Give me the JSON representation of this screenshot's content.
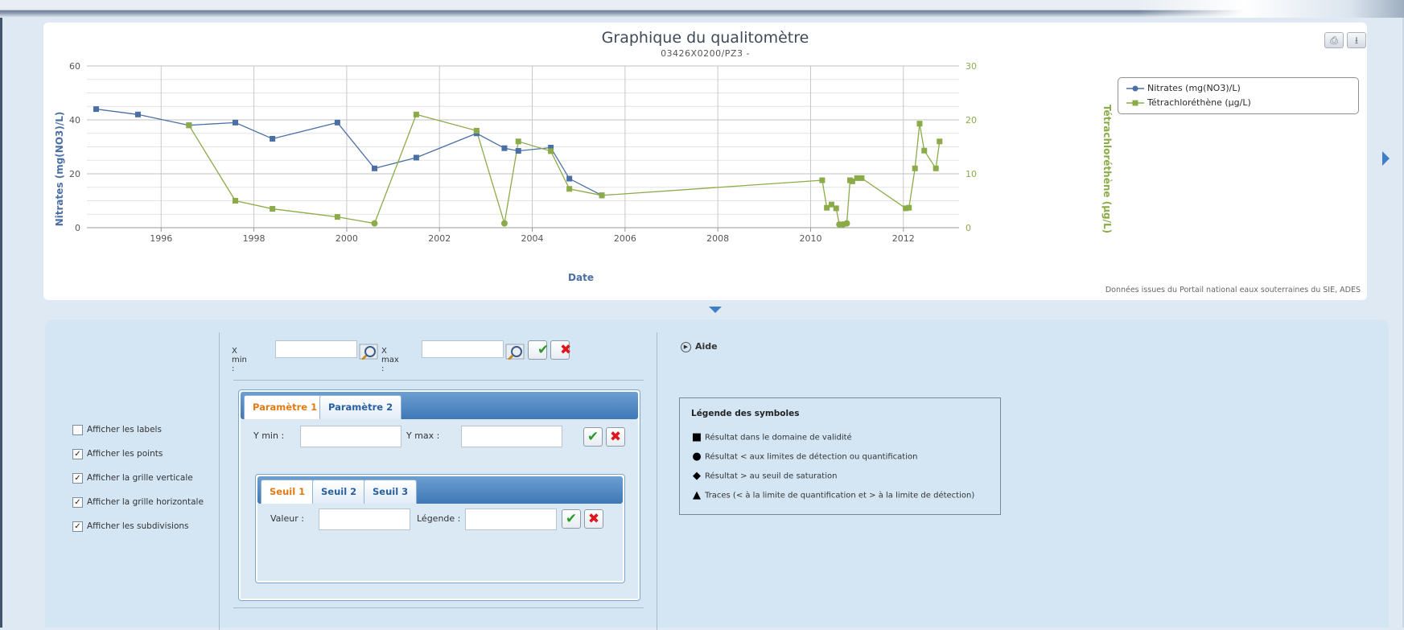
{
  "chart_data": {
    "type": "line",
    "title": "Graphique du qualitomètre",
    "subtitle": "03426X0200/PZ3 -",
    "xlabel": "Date",
    "ylabel_left": "Nitrates (mg(NO3)/L)",
    "ylabel_right": "Tétrachloréthène (µg/L)",
    "xlim": [
      1994.4,
      2013.2
    ],
    "ylim_left": [
      0,
      60
    ],
    "ylim_right": [
      0,
      30
    ],
    "x_ticks": [
      "1996",
      "1998",
      "2000",
      "2002",
      "2004",
      "2006",
      "2008",
      "2010",
      "2012"
    ],
    "y_ticks_left": [
      "0",
      "20",
      "40",
      "60"
    ],
    "y_ticks_right": [
      "0",
      "10",
      "20",
      "30"
    ],
    "grid": true,
    "legend_position": "top-right",
    "series": [
      {
        "name": "Nitrates (mg(NO3)/L)",
        "axis": "left",
        "color": "#4a6fa5",
        "x": [
          1994.6,
          1995.5,
          1996.6,
          1997.6,
          1998.4,
          1999.8,
          2000.6,
          2001.5,
          2002.8,
          2003.4,
          2003.7,
          2004.4,
          2004.8,
          2005.5
        ],
        "y": [
          44,
          42,
          38,
          39,
          33,
          39,
          22,
          26,
          35,
          29.5,
          28.5,
          29.7,
          18.2,
          12
        ]
      },
      {
        "name": "Tétrachloréthène (µg/L)",
        "axis": "right",
        "color": "#8bab48",
        "x": [
          1996.6,
          1997.6,
          1998.4,
          1999.8,
          2000.6,
          2001.5,
          2002.8,
          2003.4,
          2003.7,
          2004.4,
          2004.8,
          2005.5,
          2010.25,
          2010.35,
          2010.45,
          2010.55,
          2010.62,
          2010.7,
          2010.78,
          2010.85,
          2010.9,
          2011.0,
          2011.1,
          2012.05,
          2012.12,
          2012.25,
          2012.35,
          2012.45,
          2012.7,
          2012.78
        ],
        "y": [
          19,
          5,
          3.5,
          2,
          0.8,
          21,
          18,
          0.8,
          16,
          14.2,
          7.2,
          6,
          8.8,
          3.7,
          4.3,
          3.6,
          0.6,
          0.6,
          0.8,
          8.8,
          8.6,
          9.2,
          9.2,
          3.6,
          3.7,
          11,
          19.3,
          14.3,
          11,
          16
        ]
      }
    ]
  },
  "credits": "Données issues du Portail national eaux souterraines du SIE, ADES",
  "toolbar": {
    "print_icon": "print-icon",
    "export_icon": "download-icon"
  },
  "options": {
    "items": [
      {
        "label": "Afficher les labels",
        "checked": false
      },
      {
        "label": "Afficher les points",
        "checked": true
      },
      {
        "label": "Afficher la grille verticale",
        "checked": true
      },
      {
        "label": "Afficher la grille horizontale",
        "checked": true
      },
      {
        "label": "Afficher les subdivisions",
        "checked": true
      }
    ]
  },
  "xrange": {
    "xmin_label": "X min :",
    "xmax_label": "X max :",
    "xmin_value": "",
    "xmax_value": ""
  },
  "params": {
    "tabs": [
      "Paramètre 1",
      "Paramètre 2"
    ],
    "active_tab": "Paramètre 1",
    "ymin_label": "Y min :",
    "ymax_label": "Y max :",
    "ymin_value": "",
    "ymax_value": ""
  },
  "seuils": {
    "tabs": [
      "Seuil 1",
      "Seuil 2",
      "Seuil 3"
    ],
    "active_tab": "Seuil 1",
    "valeur_label": "Valeur :",
    "legende_label": "Légende :",
    "valeur_value": "",
    "legende_value": ""
  },
  "aide": {
    "label": "Aide"
  },
  "symbols_legend": {
    "title": "Légende des symboles",
    "items": [
      {
        "shape": "■",
        "icon": "square-icon",
        "text": "Résultat dans le domaine de validité"
      },
      {
        "shape": "●",
        "icon": "circle-icon",
        "text": "Résultat < aux limites de détection ou quantification"
      },
      {
        "shape": "◆",
        "icon": "diamond-icon",
        "text": "Résultat > au seuil de saturation"
      },
      {
        "shape": "▲",
        "icon": "triangle-icon",
        "text": "Traces (< à la limite de quantification et > à la limite de détection)"
      }
    ]
  }
}
